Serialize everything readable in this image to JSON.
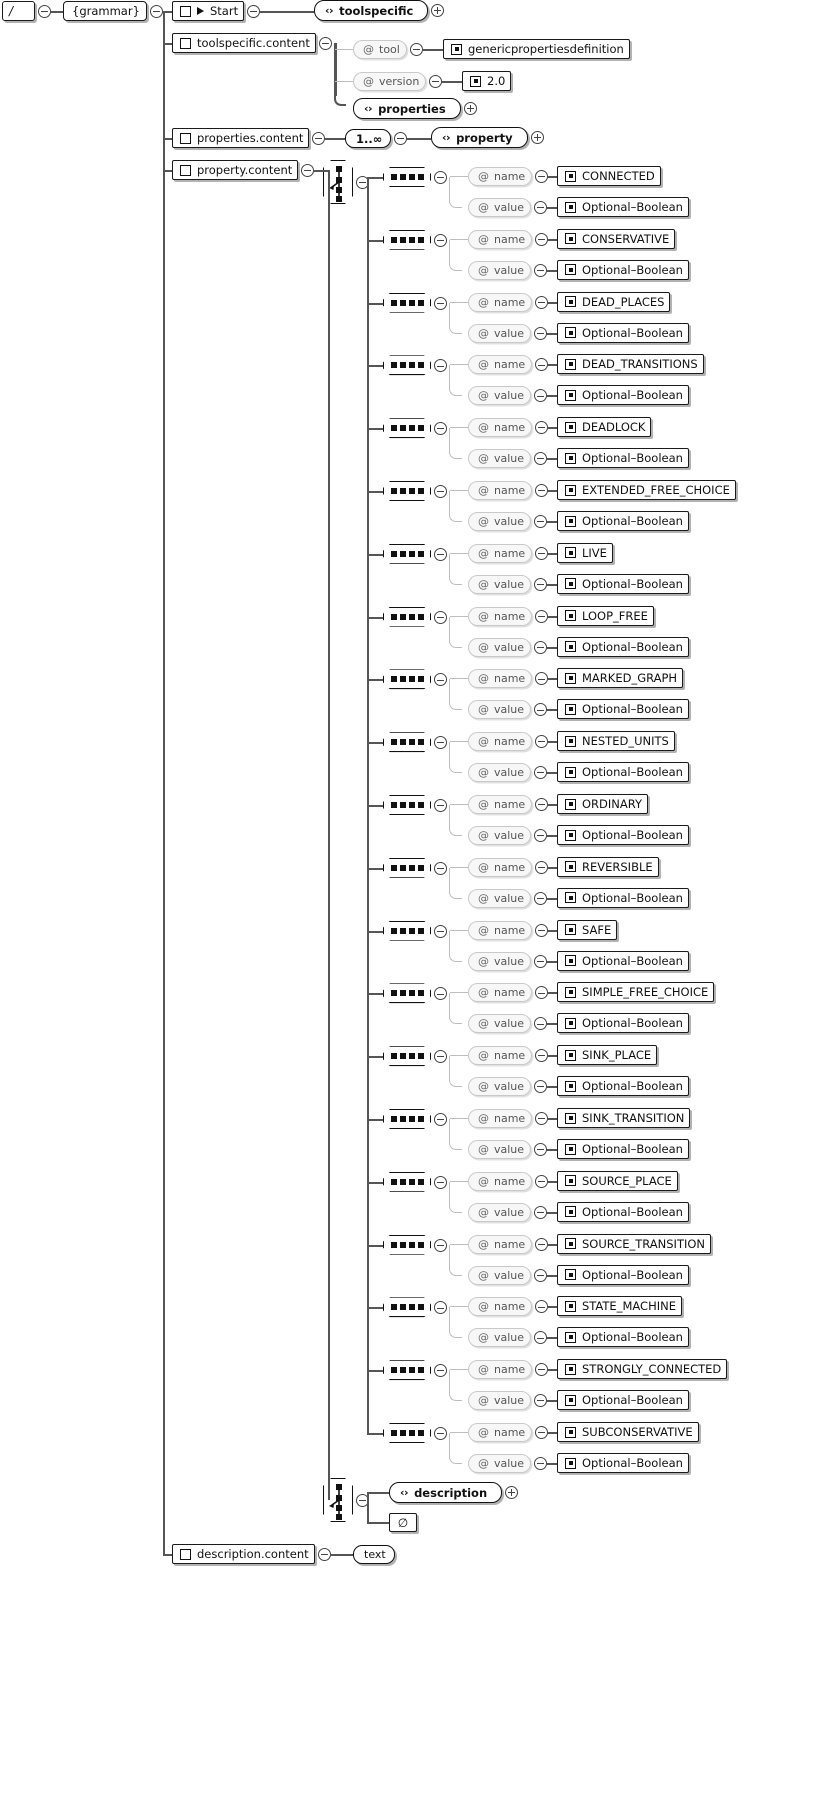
{
  "diagram": {
    "title": "XML Schema structure diagram",
    "root_label": "/",
    "grammar_label": "{grammar}",
    "icons": {
      "collapse": "minus-toggle-icon",
      "expand": "plus-toggle-icon",
      "element": "angle-brackets-icon",
      "attribute": "at-sign-icon",
      "datatype": "filled-square-icon",
      "sequence": "sequence-node-icon",
      "choice": "choice-node-icon",
      "start": "start-triangle-icon"
    },
    "colors": {
      "stroke": "#555555",
      "thin_stroke": "#bdbdbd",
      "node_border": "#111111",
      "attr_fill": "#f7f7f7",
      "attr_border": "#c9c9c9",
      "background": "#ffffff"
    }
  },
  "definitions": {
    "start": {
      "label": "Start",
      "target": "toolspecific"
    },
    "toolspecific_content": {
      "label": "toolspecific.content",
      "attributes": [
        {
          "name": "tool",
          "type": "genericpropertiesdefinition"
        },
        {
          "name": "version",
          "type": "2.0"
        }
      ],
      "element": "properties"
    },
    "properties_content": {
      "label": "properties.content",
      "occurrence": "1..∞",
      "element": "property"
    },
    "property_content": {
      "label": "property.content"
    },
    "description_content": {
      "label": "description.content",
      "leaf": "text"
    }
  },
  "property_choice": {
    "attr_name_label": "name",
    "attr_value_label": "value",
    "value_type": "Optional–Boolean",
    "branches": [
      "CONNECTED",
      "CONSERVATIVE",
      "DEAD_PLACES",
      "DEAD_TRANSITIONS",
      "DEADLOCK",
      "EXTENDED_FREE_CHOICE",
      "LIVE",
      "LOOP_FREE",
      "MARKED_GRAPH",
      "NESTED_UNITS",
      "ORDINARY",
      "REVERSIBLE",
      "SAFE",
      "SIMPLE_FREE_CHOICE",
      "SINK_PLACE",
      "SINK_TRANSITION",
      "SOURCE_PLACE",
      "SOURCE_TRANSITION",
      "STATE_MACHINE",
      "STRONGLY_CONNECTED",
      "SUBCONSERVATIVE"
    ]
  },
  "description_choice": {
    "element": "description",
    "empty_symbol": "∅"
  }
}
